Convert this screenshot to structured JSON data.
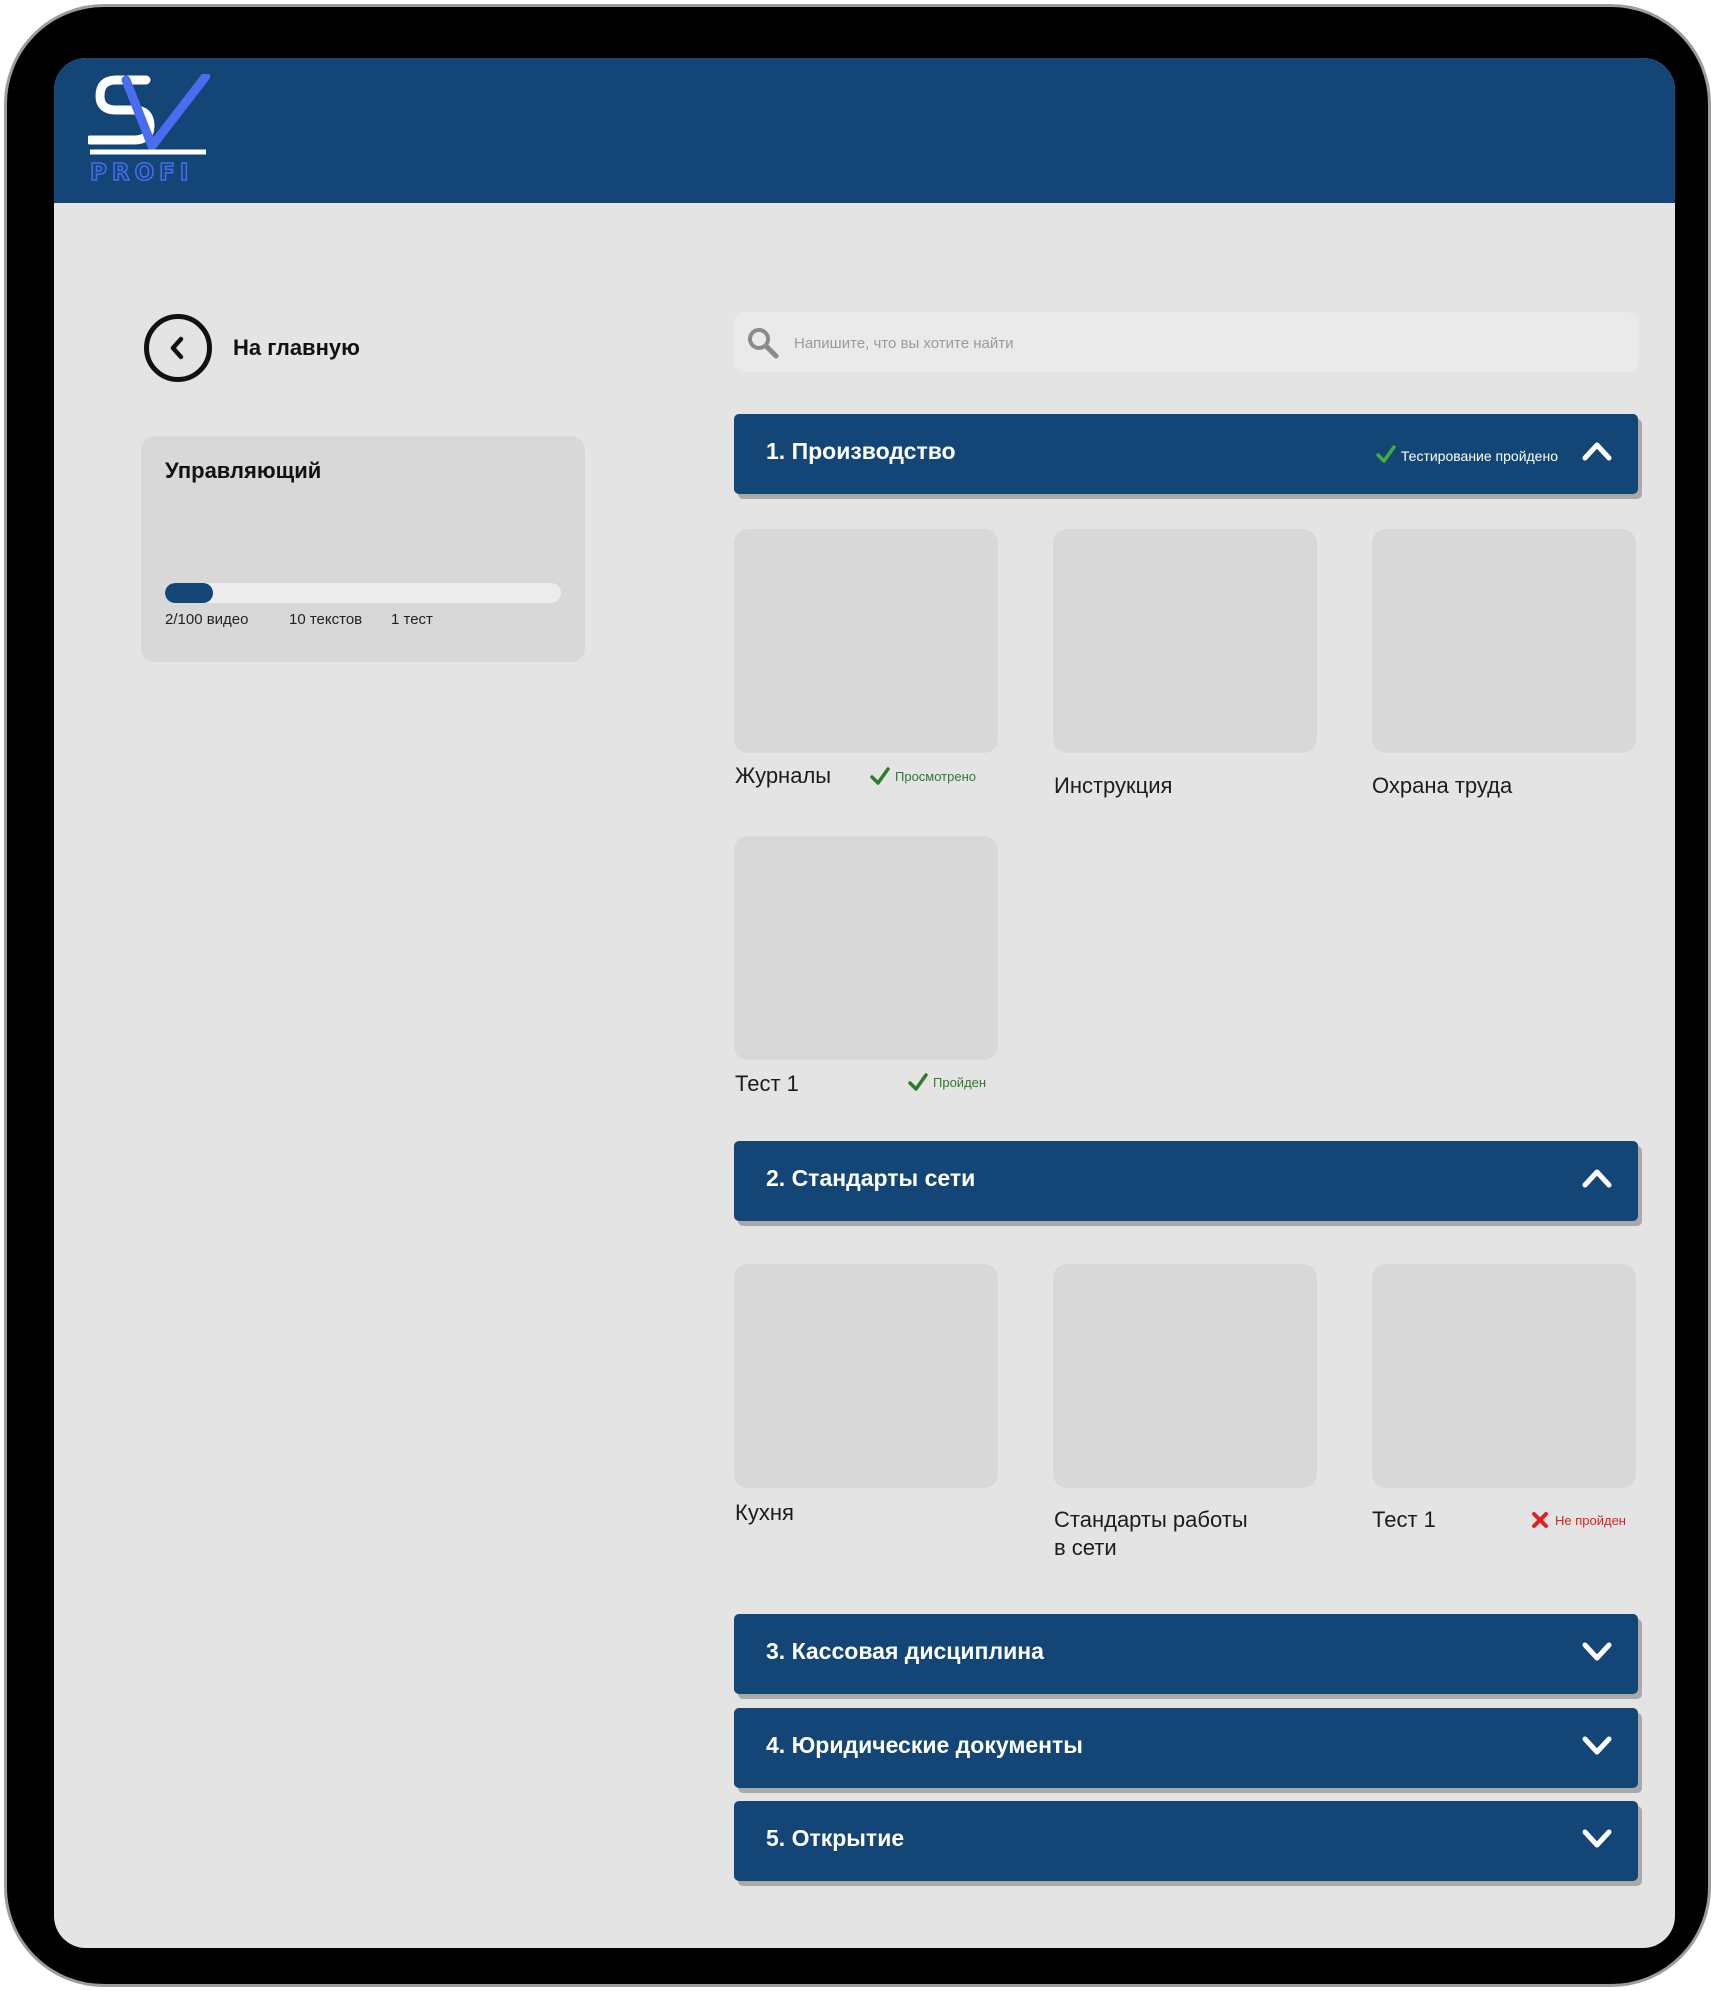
{
  "brand": {
    "logo_text": "PROFI",
    "logo_letters": "SV"
  },
  "nav": {
    "back_label": "На главную"
  },
  "role_card": {
    "title": "Управляющий",
    "progress": 0.12,
    "stats": {
      "videos": "2/100 видео",
      "texts": "10 текстов",
      "tests": "1 тест"
    }
  },
  "search": {
    "placeholder": "Напишите, что вы хотите найти",
    "value": ""
  },
  "sections": [
    {
      "title": "1. Производство",
      "status": "Тестирование пройдено",
      "expanded": true,
      "items": [
        {
          "label": "Журналы",
          "badge": "Просмотрено",
          "badge_kind": "ok"
        },
        {
          "label": "Инструкция"
        },
        {
          "label": "Охрана труда"
        },
        {
          "label": "Тест 1",
          "badge": "Пройден",
          "badge_kind": "ok"
        }
      ]
    },
    {
      "title": "2. Стандарты сети",
      "expanded": true,
      "items": [
        {
          "label": "Кухня"
        },
        {
          "label": "Стандарты работы",
          "label_line2": "в сети"
        },
        {
          "label": "Тест 1",
          "badge": "Не пройден",
          "badge_kind": "fail"
        }
      ]
    },
    {
      "title": "3. Кассовая дисциплина",
      "expanded": false
    },
    {
      "title": "4. Юридические документы",
      "expanded": false
    },
    {
      "title": "5. Открытие",
      "expanded": false
    }
  ],
  "colors": {
    "brand_blue": "#134677",
    "logo_accent": "#4a6cf0",
    "screen_background": "#e4e4e4",
    "card_background": "#d8d8d8",
    "success_green": "#2f7a2f",
    "fail_red": "#e02020"
  },
  "icons": {
    "back": "chevron-left-circle-icon",
    "search": "search-icon",
    "expanded": "chevron-up-icon",
    "collapsed": "chevron-down-icon",
    "ok": "check-icon",
    "fail": "cross-icon"
  }
}
